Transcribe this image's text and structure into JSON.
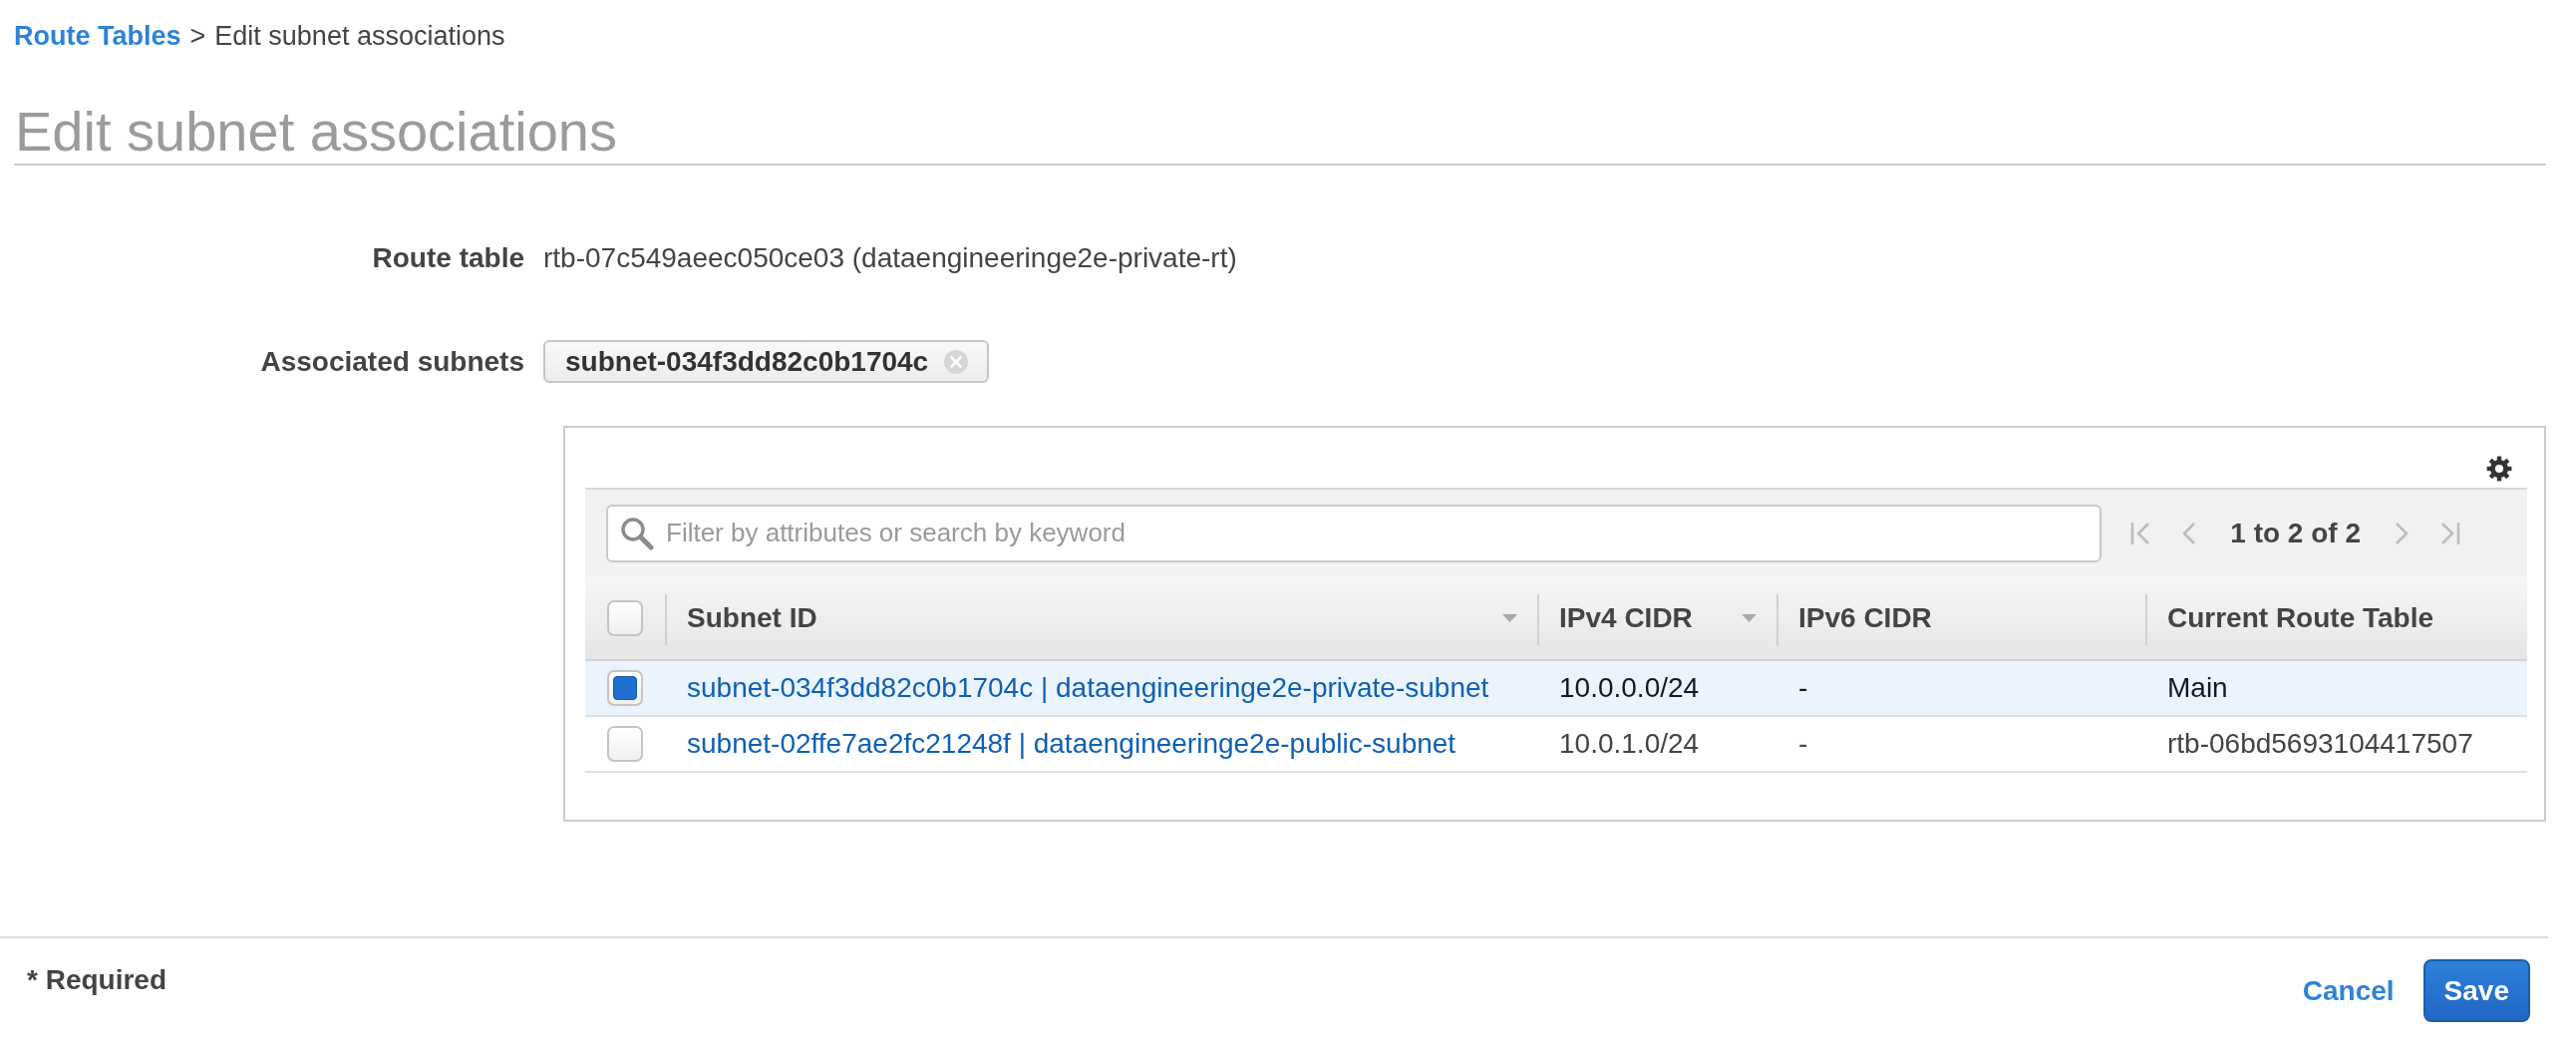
{
  "breadcrumb": {
    "items": [
      {
        "label": "Route Tables",
        "kind": "link"
      },
      {
        "label": "Edit subnet associations",
        "kind": "current"
      }
    ],
    "separator": ">"
  },
  "page_title": "Edit subnet associations",
  "form": {
    "fields": [
      {
        "label": "Route table",
        "kind": "text",
        "value": "rtb-07c549aeec050ce03 (dataengineeringe2e-private-rt)"
      },
      {
        "label": "Associated subnets",
        "kind": "tokens",
        "tokens": [
          "subnet-034f3dd82c0b1704c"
        ]
      }
    ]
  },
  "subnet_table": {
    "search": {
      "placeholder": "Filter by attributes or search by keyword"
    },
    "pagination": {
      "range": "1 to 2 of 2",
      "buttons": [
        {
          "kind": "first",
          "disabled": true
        },
        {
          "kind": "previous",
          "disabled": true
        },
        {
          "kind": "next",
          "disabled": true
        },
        {
          "kind": "last",
          "disabled": true
        }
      ]
    },
    "select_all": {
      "checked": false
    },
    "columns": [
      {
        "label": "Subnet ID",
        "kind": "link",
        "sortable": true
      },
      {
        "label": "IPv4 CIDR",
        "kind": "text",
        "sortable": true
      },
      {
        "label": "IPv6 CIDR",
        "kind": "text",
        "sortable": false
      },
      {
        "label": "Current Route Table",
        "kind": "text",
        "sortable": false
      }
    ],
    "rows": [
      {
        "selected": true,
        "cells": [
          "subnet-034f3dd82c0b1704c | dataengineeringe2e-private-subnet",
          "10.0.0.0/24",
          "-",
          "Main"
        ]
      },
      {
        "selected": false,
        "cells": [
          "subnet-02ffe7ae2fc21248f | dataengineeringe2e-public-subnet",
          "10.0.1.0/24",
          "-",
          "rtb-06bd5693104417507"
        ]
      }
    ]
  },
  "footer": {
    "required_note": "* Required",
    "buttons": [
      {
        "label": "Cancel",
        "kind": "cancel"
      },
      {
        "label": "Save",
        "kind": "save"
      }
    ]
  }
}
